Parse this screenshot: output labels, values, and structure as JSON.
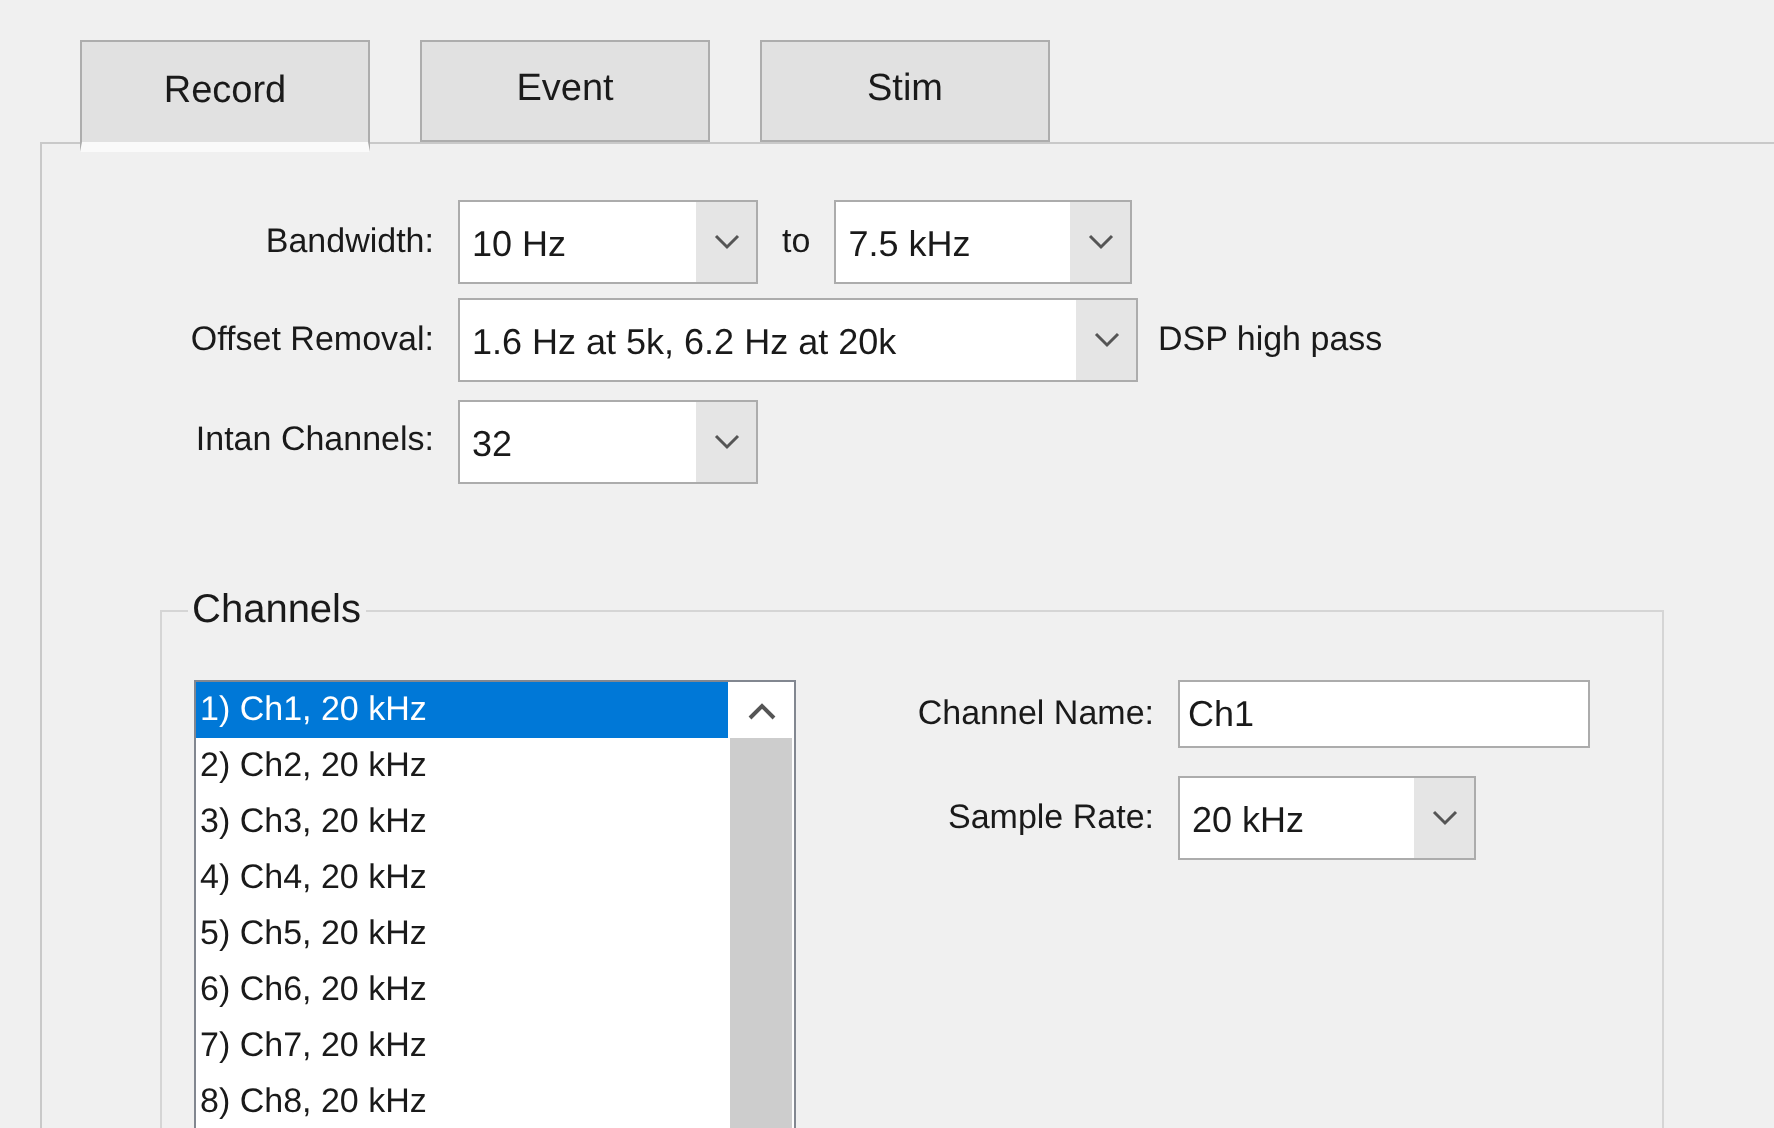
{
  "tabs": [
    {
      "label": "Record",
      "selected": true
    },
    {
      "label": "Event",
      "selected": false
    },
    {
      "label": "Stim",
      "selected": false
    }
  ],
  "bandwidth": {
    "label": "Bandwidth:",
    "from": "10 Hz",
    "separator": "to",
    "to": "7.5 kHz"
  },
  "offset_removal": {
    "label": "Offset Removal:",
    "value": "1.6 Hz at 5k, 6.2 Hz at 20k",
    "note": "DSP high pass"
  },
  "intan_channels": {
    "label": "Intan Channels:",
    "value": "32"
  },
  "channels_group": {
    "title": "Channels",
    "list": [
      {
        "text": "1) Ch1, 20 kHz",
        "selected": true
      },
      {
        "text": "2) Ch2, 20 kHz",
        "selected": false
      },
      {
        "text": "3) Ch3, 20 kHz",
        "selected": false
      },
      {
        "text": "4) Ch4, 20 kHz",
        "selected": false
      },
      {
        "text": "5) Ch5, 20 kHz",
        "selected": false
      },
      {
        "text": "6) Ch6, 20 kHz",
        "selected": false
      },
      {
        "text": "7) Ch7, 20 kHz",
        "selected": false
      },
      {
        "text": "8) Ch8, 20 kHz",
        "selected": false
      }
    ],
    "channel_name": {
      "label": "Channel Name:",
      "value": "Ch1"
    },
    "sample_rate": {
      "label": "Sample Rate:",
      "value": "20 kHz"
    }
  }
}
